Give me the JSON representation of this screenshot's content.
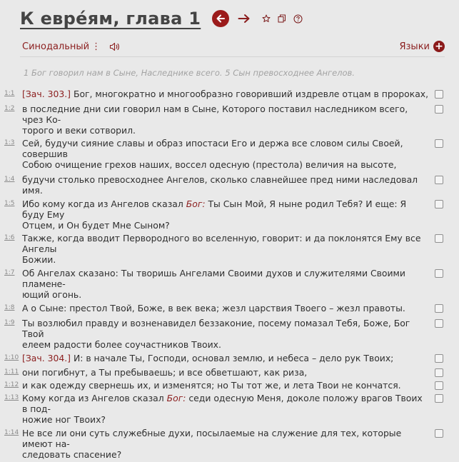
{
  "header": {
    "title": "К евре́ям, глава 1",
    "icons": [
      "arrow-left-circle-icon",
      "arrow-right-icon",
      "star-icon",
      "copy-icon",
      "help-icon"
    ]
  },
  "toolbar": {
    "translation": "Синодальный",
    "menu_glyph": "⋮",
    "languages_label": "Языки",
    "add_glyph": "+"
  },
  "summary": "1 Бог говорил нам в Сыне, Наследнике всего. 5 Сын превосходнее Ангелов.",
  "colors": {
    "accent": "#8b1e1e",
    "background": "#e9e9e9"
  },
  "verses": [
    {
      "ref": "1:1",
      "lines": [
        [
          {
            "t": "[Зач. 303.]",
            "s": "zach"
          },
          {
            "t": " Бог, многократно и многообразно говоривший издревле отцам в пророках,"
          }
        ]
      ]
    },
    {
      "ref": "1:2",
      "lines": [
        [
          {
            "t": "в последние дни сии говорил нам в Сыне, Которого поставил наследником всего, чрез Ко-"
          }
        ],
        [
          {
            "t": "торого и веки сотворил."
          }
        ]
      ]
    },
    {
      "ref": "1:3",
      "lines": [
        [
          {
            "t": "Сей, будучи сияние славы и образ ипостаси Его и держа все словом силы Своей, совершив"
          }
        ],
        [
          {
            "t": "Собою очищение грехов наших, воссел одесную (престола) величия на высоте,"
          }
        ]
      ]
    },
    {
      "ref": "1:4",
      "lines": [
        [
          {
            "t": "будучи столько превосходнее Ангелов, сколько славнейшее пред ними наследовал имя."
          }
        ]
      ]
    },
    {
      "ref": "1:5",
      "lines": [
        [
          {
            "t": "Ибо кому когда из Ангелов сказал "
          },
          {
            "t": "Бог:",
            "s": "bog"
          },
          {
            "t": " Ты Сын Мой, Я ныне родил Тебя? И еще: Я буду Ему"
          }
        ],
        [
          {
            "t": "Отцем, и Он будет Мне Сыном?"
          }
        ]
      ]
    },
    {
      "ref": "1:6",
      "lines": [
        [
          {
            "t": "Также, когда вводит Первородного во вселенную, говорит: и да поклонятся Ему все Ангелы"
          }
        ],
        [
          {
            "t": "Божии."
          }
        ]
      ]
    },
    {
      "ref": "1:7",
      "lines": [
        [
          {
            "t": "Об Ангелах сказано: Ты творишь Ангелами Своими духов и служителями Своими пламене-"
          }
        ],
        [
          {
            "t": "ющий огонь."
          }
        ]
      ]
    },
    {
      "ref": "1:8",
      "lines": [
        [
          {
            "t": "А о Сыне: престол Твой, Боже, в век века; жезл царствия Твоего – жезл правоты."
          }
        ]
      ]
    },
    {
      "ref": "1:9",
      "lines": [
        [
          {
            "t": "Ты возлюбил правду и возненавидел беззаконие, посему помазал Тебя, Боже, Бог Твой"
          }
        ],
        [
          {
            "t": "елеем радости более соучастников Твоих."
          }
        ]
      ]
    },
    {
      "ref": "1:10",
      "lines": [
        [
          {
            "t": "[Зач. 304.]",
            "s": "zach"
          },
          {
            "t": " И: в начале Ты, Господи, основал землю, и небеса – дело рук Твоих;"
          }
        ]
      ]
    },
    {
      "ref": "1:11",
      "lines": [
        [
          {
            "t": "они погибнут, а Ты пребываешь; и все обветшают, как риза,"
          }
        ]
      ]
    },
    {
      "ref": "1:12",
      "lines": [
        [
          {
            "t": "и как одежду свернешь их, и изменятся; но Ты тот же, и лета Твои не кончатся."
          }
        ]
      ]
    },
    {
      "ref": "1:13",
      "lines": [
        [
          {
            "t": "Кому когда из Ангелов сказал "
          },
          {
            "t": "Бог:",
            "s": "bog"
          },
          {
            "t": " седи одесную Меня, доколе положу врагов Твоих в под-"
          }
        ],
        [
          {
            "t": "ножие ног Твоих?"
          }
        ]
      ]
    },
    {
      "ref": "1:14",
      "lines": [
        [
          {
            "t": "Не все ли они суть служебные духи, посылаемые на служение для тех, которые имеют на-"
          }
        ],
        [
          {
            "t": "следовать спасение?"
          }
        ]
      ]
    }
  ]
}
